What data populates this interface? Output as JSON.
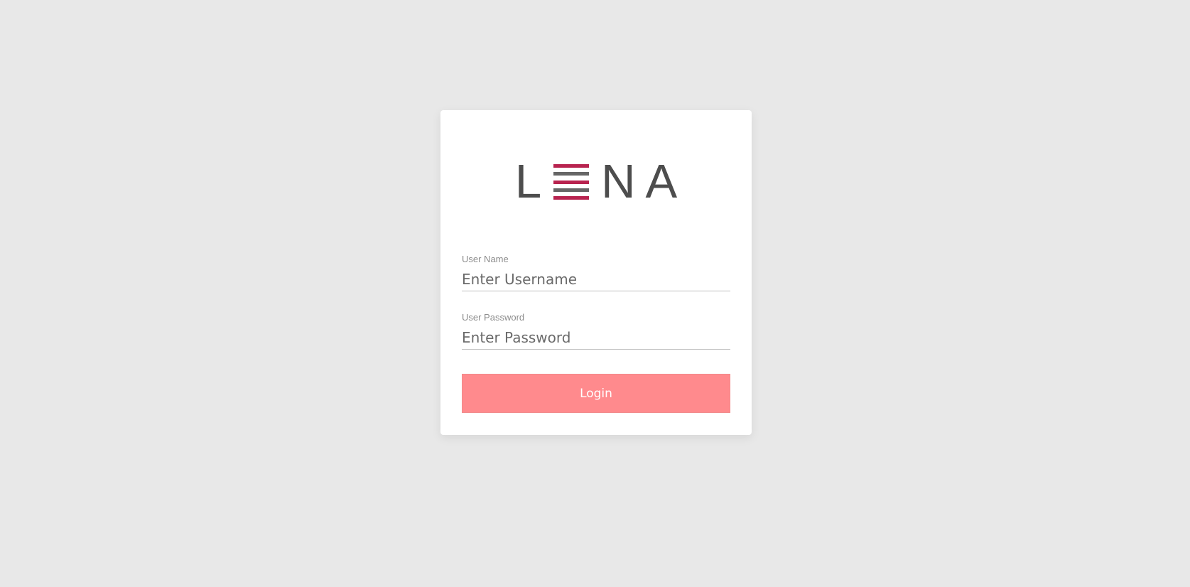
{
  "logo": {
    "letter_l": "L",
    "letter_n": "N",
    "letter_a": "A",
    "stripe_colors": [
      "#b8234f",
      "#666666",
      "#b8234f",
      "#666666",
      "#b8234f"
    ]
  },
  "form": {
    "username": {
      "label": "User Name",
      "placeholder": "Enter Username",
      "value": ""
    },
    "password": {
      "label": "User Password",
      "placeholder": "Enter Password",
      "value": ""
    },
    "login_label": "Login"
  },
  "colors": {
    "background": "#e8e8e8",
    "card": "#ffffff",
    "button": "#ff8a8d",
    "logo_text": "#4d4d4d",
    "logo_accent": "#b8234f"
  }
}
